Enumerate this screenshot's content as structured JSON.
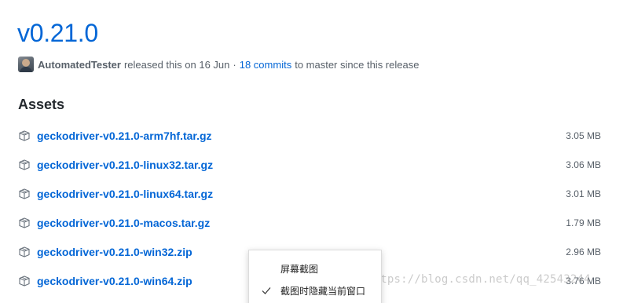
{
  "release": {
    "title": "v0.21.0",
    "author": "AutomatedTester",
    "released_text": "released this on 16 Jun",
    "separator": "·",
    "commits_link": "18 commits",
    "commits_suffix": "to master since this release"
  },
  "assets": {
    "heading": "Assets",
    "items": [
      {
        "name": "geckodriver-v0.21.0-arm7hf.tar.gz",
        "size": "3.05 MB",
        "icon": "package-icon"
      },
      {
        "name": "geckodriver-v0.21.0-linux32.tar.gz",
        "size": "3.06 MB",
        "icon": "package-icon"
      },
      {
        "name": "geckodriver-v0.21.0-linux64.tar.gz",
        "size": "3.01 MB",
        "icon": "package-icon"
      },
      {
        "name": "geckodriver-v0.21.0-macos.tar.gz",
        "size": "1.79 MB",
        "icon": "package-icon"
      },
      {
        "name": "geckodriver-v0.21.0-win32.zip",
        "size": "2.96 MB",
        "icon": "package-icon"
      },
      {
        "name": "geckodriver-v0.21.0-win64.zip",
        "size": "3.76 MB",
        "icon": "package-icon"
      }
    ]
  },
  "context_menu": {
    "items": [
      {
        "label": "屏幕截图",
        "checked": false
      },
      {
        "label": "截图时隐藏当前窗口",
        "checked": true
      }
    ]
  },
  "watermark": "https://blog.csdn.net/qq_42543244",
  "colors": {
    "link": "#0366d6",
    "text": "#24292e",
    "muted": "#586069"
  }
}
